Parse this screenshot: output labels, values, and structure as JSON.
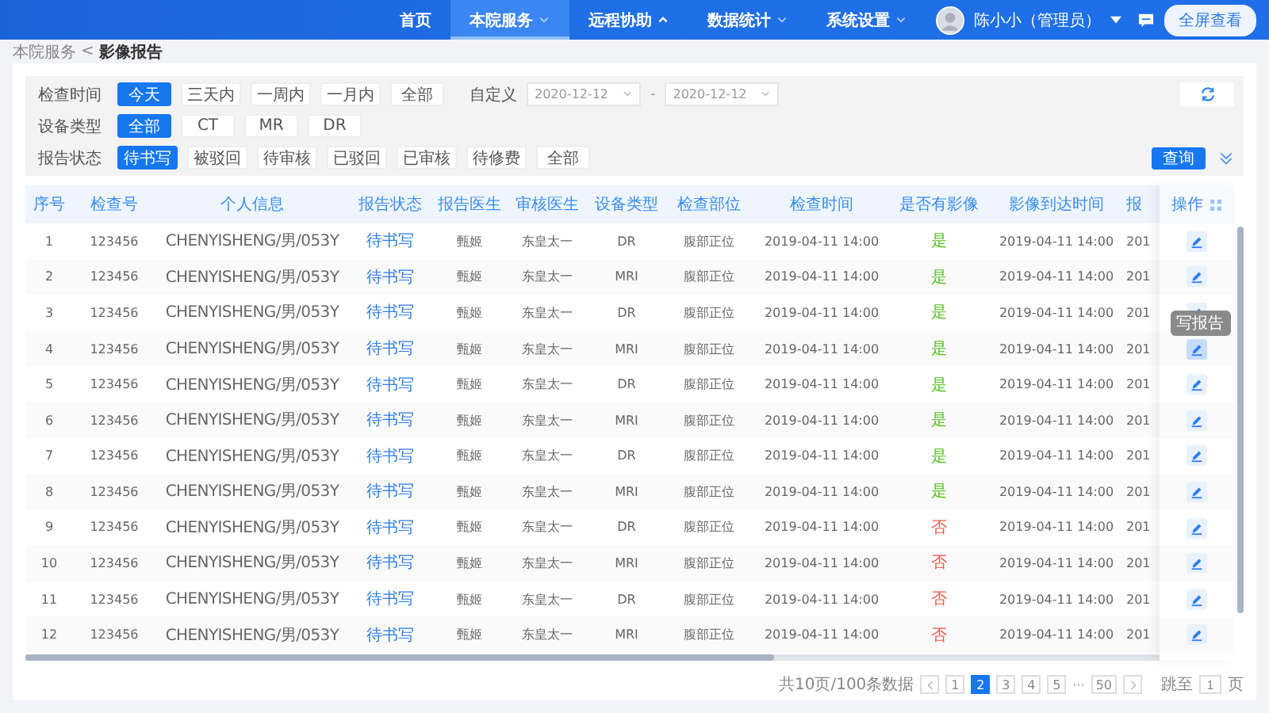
{
  "nav": {
    "items": [
      {
        "label": "首页",
        "selected": false
      },
      {
        "label": "本院服务",
        "selected": true,
        "dropdown": true,
        "expanded": false
      },
      {
        "label": "远程协助",
        "selected": false,
        "dropdown": true,
        "expanded": true
      },
      {
        "label": "数据统计",
        "selected": false,
        "dropdown": true,
        "expanded": false
      },
      {
        "label": "系统设置",
        "selected": false,
        "dropdown": true,
        "expanded": false
      }
    ],
    "user": "陈小小（管理员）",
    "fullscreen_button": "全屏查看"
  },
  "breadcrumb": {
    "parent": "本院服务",
    "separator": "<",
    "current": "影像报告"
  },
  "filters": {
    "groups": [
      {
        "label": "检查时间",
        "options": [
          {
            "label": "今天",
            "selected": true
          },
          {
            "label": "三天内",
            "selected": false
          },
          {
            "label": "一周内",
            "selected": false
          },
          {
            "label": "一月内",
            "selected": false
          },
          {
            "label": "全部",
            "selected": false
          }
        ]
      },
      {
        "label": "设备类型",
        "options": [
          {
            "label": "全部",
            "selected": true
          },
          {
            "label": "CT",
            "selected": false
          },
          {
            "label": "MR",
            "selected": false
          },
          {
            "label": "DR",
            "selected": false
          }
        ]
      },
      {
        "label": "报告状态",
        "options": [
          {
            "label": "待书写",
            "selected": true
          },
          {
            "label": "被驳回",
            "selected": false
          },
          {
            "label": "待审核",
            "selected": false
          },
          {
            "label": "已驳回",
            "selected": false
          },
          {
            "label": "已审核",
            "selected": false
          },
          {
            "label": "待修费",
            "selected": false
          },
          {
            "label": "全部",
            "selected": false
          }
        ]
      }
    ],
    "custom": {
      "label": "自定义",
      "start": "2020-12-12",
      "separator": "-",
      "end": "2020-12-12"
    },
    "query_button": "查询"
  },
  "table": {
    "columns": [
      "序号",
      "检查号",
      "个人信息",
      "报告状态",
      "报告医生",
      "审核医生",
      "设备类型",
      "检查部位",
      "检查时间",
      "是否有影像",
      "影像到达时间",
      "报"
    ],
    "action_column": "操作",
    "rows": [
      {
        "no": "1",
        "exam_no": "123456",
        "patient": "CHENYISHENG/男/053Y",
        "status": "待书写",
        "report_doctor": "甄姬",
        "review_doctor": "东皇太一",
        "device": "DR",
        "body_part": "腹部正位",
        "exam_time": "2019-04-11 14:00",
        "has_image": "是",
        "image_ok": true,
        "arrival_time": "2019-04-11 14:00",
        "column_12": "201",
        "hovered": false
      },
      {
        "no": "2",
        "exam_no": "123456",
        "patient": "CHENYISHENG/男/053Y",
        "status": "待书写",
        "report_doctor": "甄姬",
        "review_doctor": "东皇太一",
        "device": "MRI",
        "body_part": "腹部正位",
        "exam_time": "2019-04-11 14:00",
        "has_image": "是",
        "image_ok": true,
        "arrival_time": "2019-04-11 14:00",
        "column_12": "201",
        "hovered": false
      },
      {
        "no": "3",
        "exam_no": "123456",
        "patient": "CHENYISHENG/男/053Y",
        "status": "待书写",
        "report_doctor": "甄姬",
        "review_doctor": "东皇太一",
        "device": "DR",
        "body_part": "腹部正位",
        "exam_time": "2019-04-11 14:00",
        "has_image": "是",
        "image_ok": true,
        "arrival_time": "2019-04-11 14:00",
        "column_12": "201",
        "hovered": false
      },
      {
        "no": "4",
        "exam_no": "123456",
        "patient": "CHENYISHENG/男/053Y",
        "status": "待书写",
        "report_doctor": "甄姬",
        "review_doctor": "东皇太一",
        "device": "MRI",
        "body_part": "腹部正位",
        "exam_time": "2019-04-11 14:00",
        "has_image": "是",
        "image_ok": true,
        "arrival_time": "2019-04-11 14:00",
        "column_12": "201",
        "hovered": true,
        "tooltip": "写报告"
      },
      {
        "no": "5",
        "exam_no": "123456",
        "patient": "CHENYISHENG/男/053Y",
        "status": "待书写",
        "report_doctor": "甄姬",
        "review_doctor": "东皇太一",
        "device": "DR",
        "body_part": "腹部正位",
        "exam_time": "2019-04-11 14:00",
        "has_image": "是",
        "image_ok": true,
        "arrival_time": "2019-04-11 14:00",
        "column_12": "201",
        "hovered": false
      },
      {
        "no": "6",
        "exam_no": "123456",
        "patient": "CHENYISHENG/男/053Y",
        "status": "待书写",
        "report_doctor": "甄姬",
        "review_doctor": "东皇太一",
        "device": "MRI",
        "body_part": "腹部正位",
        "exam_time": "2019-04-11 14:00",
        "has_image": "是",
        "image_ok": true,
        "arrival_time": "2019-04-11 14:00",
        "column_12": "201",
        "hovered": false
      },
      {
        "no": "7",
        "exam_no": "123456",
        "patient": "CHENYISHENG/男/053Y",
        "status": "待书写",
        "report_doctor": "甄姬",
        "review_doctor": "东皇太一",
        "device": "DR",
        "body_part": "腹部正位",
        "exam_time": "2019-04-11 14:00",
        "has_image": "是",
        "image_ok": true,
        "arrival_time": "2019-04-11 14:00",
        "column_12": "201",
        "hovered": false
      },
      {
        "no": "8",
        "exam_no": "123456",
        "patient": "CHENYISHENG/男/053Y",
        "status": "待书写",
        "report_doctor": "甄姬",
        "review_doctor": "东皇太一",
        "device": "MRI",
        "body_part": "腹部正位",
        "exam_time": "2019-04-11 14:00",
        "has_image": "是",
        "image_ok": true,
        "arrival_time": "2019-04-11 14:00",
        "column_12": "201",
        "hovered": false
      },
      {
        "no": "9",
        "exam_no": "123456",
        "patient": "CHENYISHENG/男/053Y",
        "status": "待书写",
        "report_doctor": "甄姬",
        "review_doctor": "东皇太一",
        "device": "DR",
        "body_part": "腹部正位",
        "exam_time": "2019-04-11 14:00",
        "has_image": "否",
        "image_ok": false,
        "arrival_time": "2019-04-11 14:00",
        "column_12": "201",
        "hovered": false
      },
      {
        "no": "10",
        "exam_no": "123456",
        "patient": "CHENYISHENG/男/053Y",
        "status": "待书写",
        "report_doctor": "甄姬",
        "review_doctor": "东皇太一",
        "device": "MRI",
        "body_part": "腹部正位",
        "exam_time": "2019-04-11 14:00",
        "has_image": "否",
        "image_ok": false,
        "arrival_time": "2019-04-11 14:00",
        "column_12": "201",
        "hovered": false
      },
      {
        "no": "11",
        "exam_no": "123456",
        "patient": "CHENYISHENG/男/053Y",
        "status": "待书写",
        "report_doctor": "甄姬",
        "review_doctor": "东皇太一",
        "device": "DR",
        "body_part": "腹部正位",
        "exam_time": "2019-04-11 14:00",
        "has_image": "否",
        "image_ok": false,
        "arrival_time": "2019-04-11 14:00",
        "column_12": "201",
        "hovered": false
      },
      {
        "no": "12",
        "exam_no": "123456",
        "patient": "CHENYISHENG/男/053Y",
        "status": "待书写",
        "report_doctor": "甄姬",
        "review_doctor": "东皇太一",
        "device": "MRI",
        "body_part": "腹部正位",
        "exam_time": "2019-04-11 14:00",
        "has_image": "否",
        "image_ok": false,
        "arrival_time": "2019-04-11 14:00",
        "column_12": "201",
        "hovered": false
      }
    ]
  },
  "pagination": {
    "summary": "共10页/100条数据",
    "pages": [
      {
        "label": "1",
        "selected": false
      },
      {
        "label": "2",
        "selected": true
      },
      {
        "label": "3",
        "selected": false
      },
      {
        "label": "4",
        "selected": false
      },
      {
        "label": "5",
        "selected": false
      }
    ],
    "ellipsis": "···",
    "last_page": "50",
    "goto_label": "跳至",
    "goto_value": "1",
    "goto_suffix": "页"
  }
}
